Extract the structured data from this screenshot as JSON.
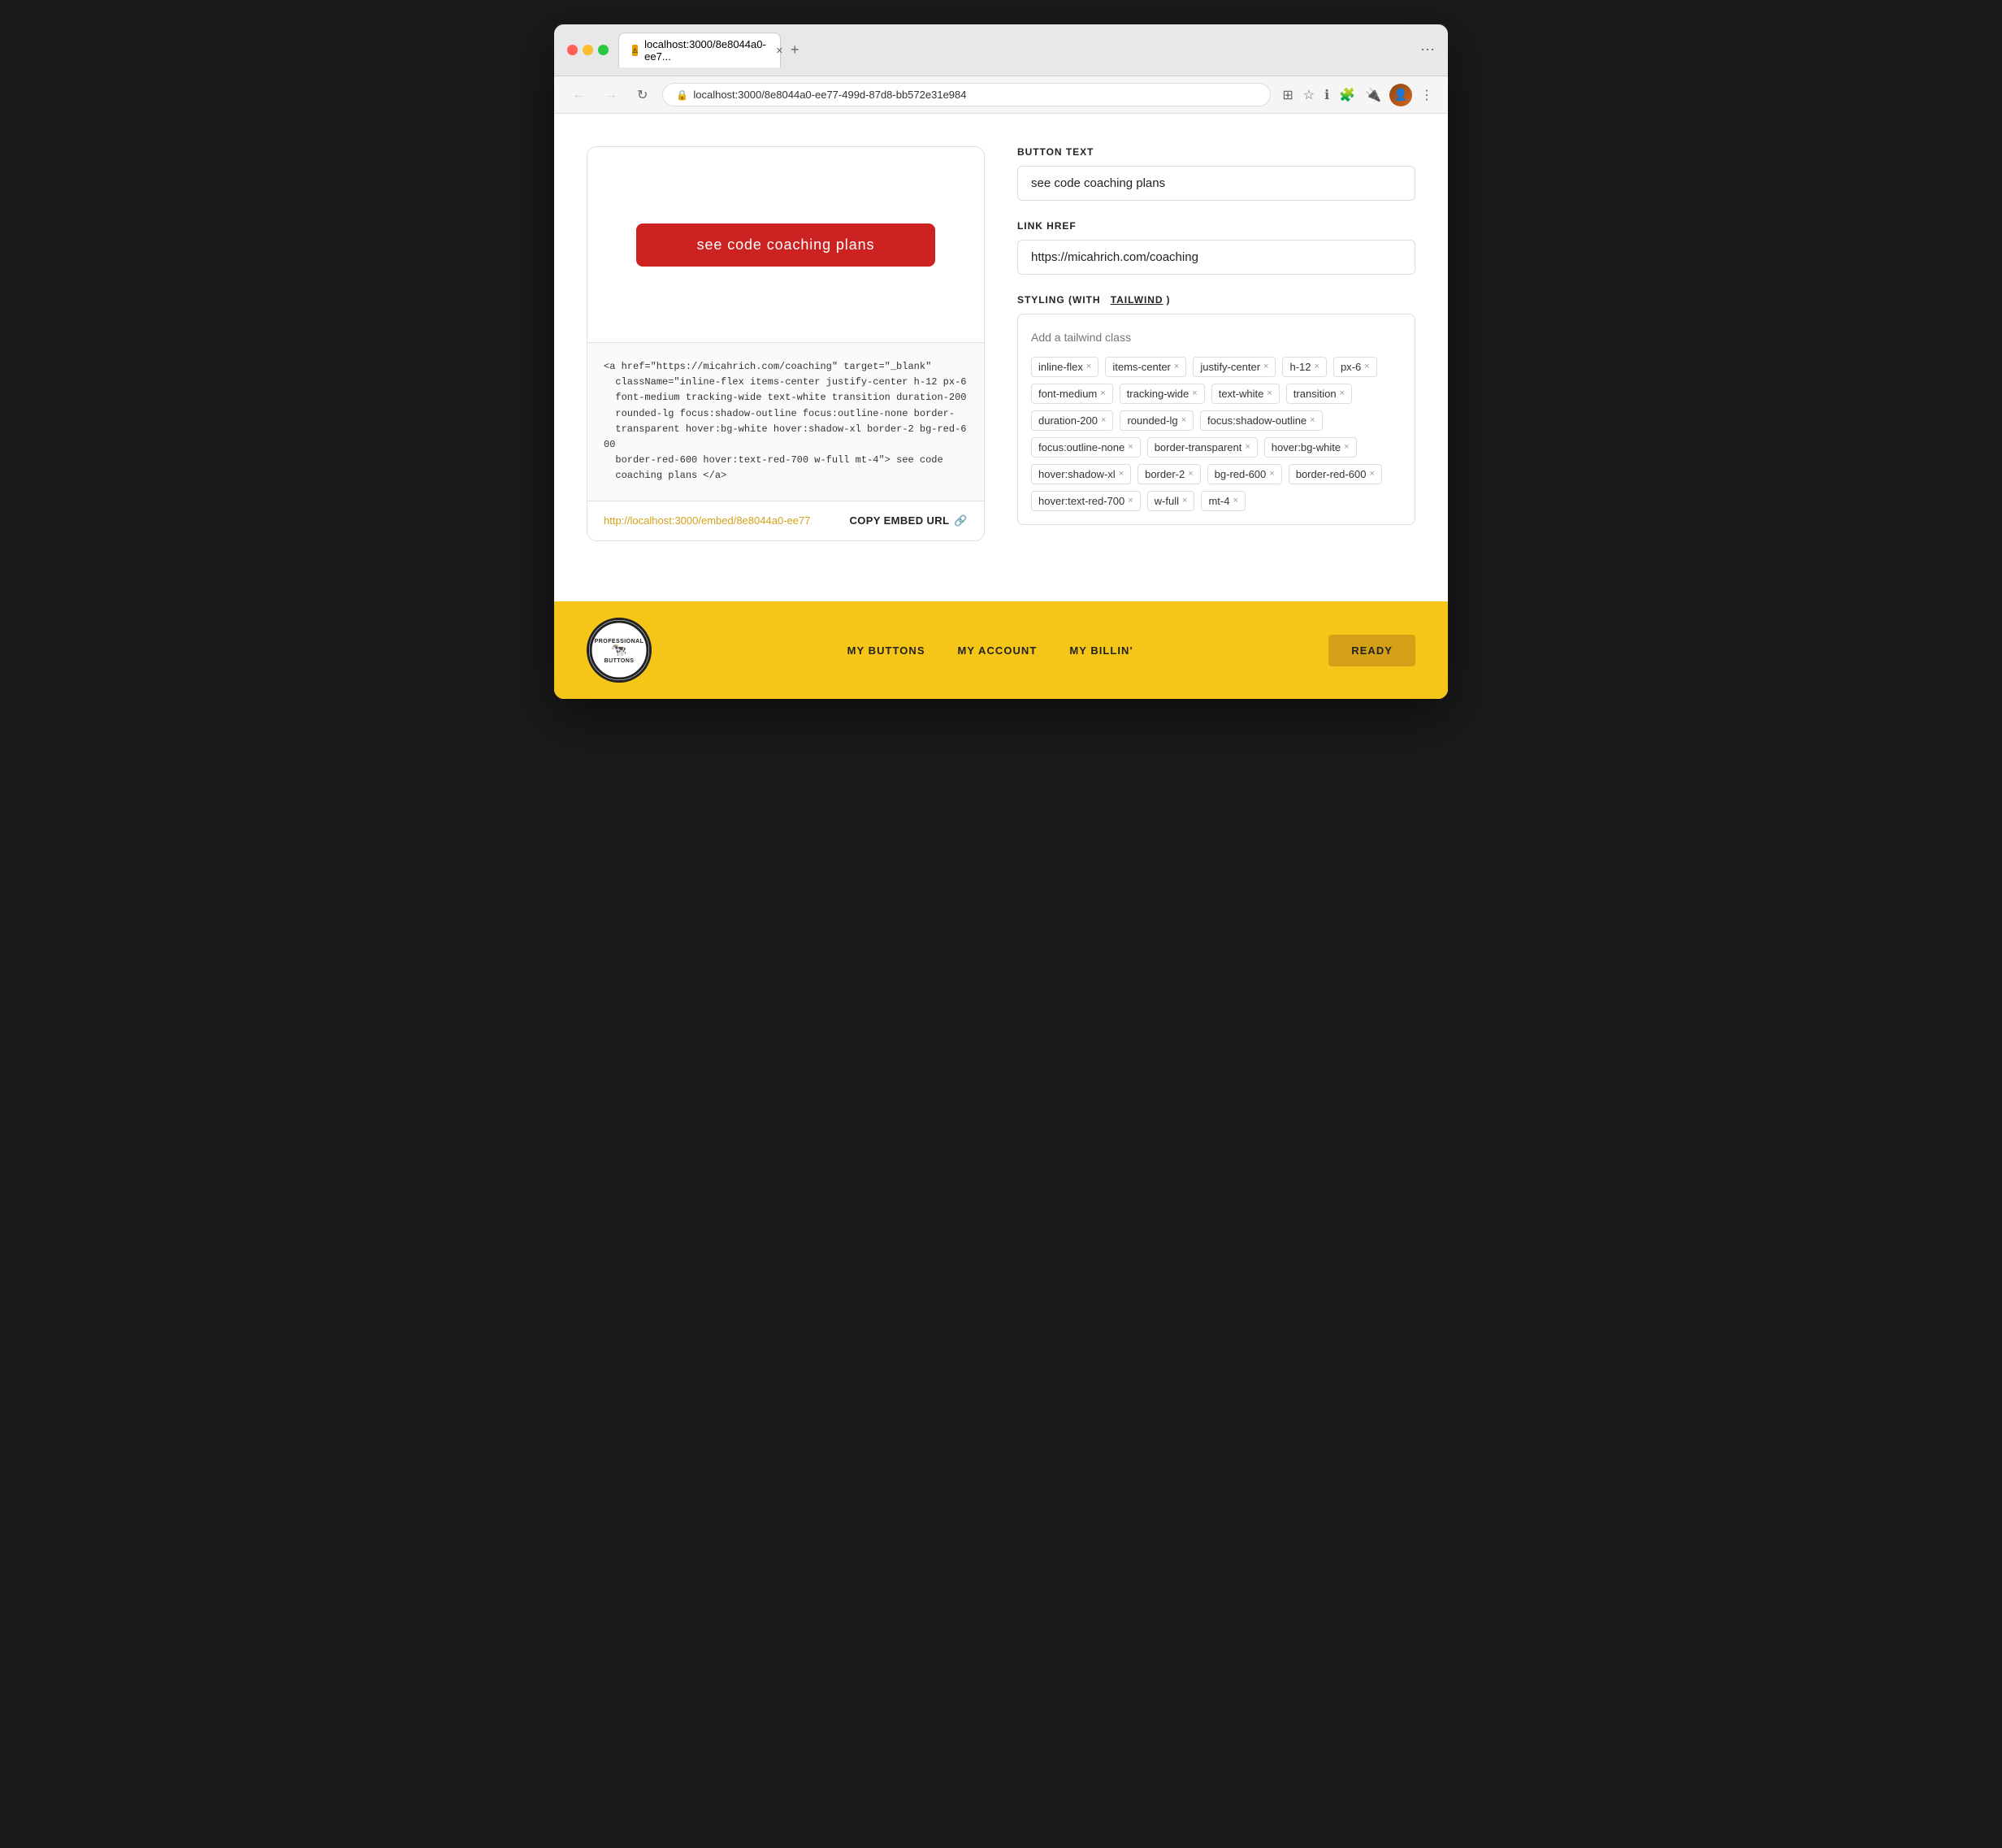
{
  "browser": {
    "tab_label": "localhost:3000/8e8044a0-ee7...",
    "address": "localhost:3000/8e8044a0-ee77-499d-87d8-bb572e31e984",
    "nav_back": "←",
    "nav_forward": "→",
    "nav_refresh": "↻"
  },
  "preview": {
    "button_text": "see code coaching plans",
    "button_style": "red"
  },
  "code": {
    "content": "<a href=\"https://micahrich.com/coaching\" target=\"_blank\"\n  className=\"inline-flex items-center justify-center h-12 px-6\n  font-medium tracking-wide text-white transition duration-200\n  rounded-lg focus:shadow-outline focus:outline-none border-\n  transparent hover:bg-white hover:shadow-xl border-2 bg-red-600\n  border-red-600 hover:text-red-700 w-full mt-4\"> see code\n  coaching plans </a>"
  },
  "embed": {
    "url": "http://localhost:3000/embed/8e8044a0-ee77",
    "copy_label": "COPY EMBED URL"
  },
  "controls": {
    "button_text_label": "BUTTON TEXT",
    "button_text_value": "see code coaching plans",
    "link_href_label": "LINK HREF",
    "link_href_value": "https://micahrich.com/coaching",
    "styling_label": "STYLING (WITH",
    "tailwind_label": "TAILWIND",
    "styling_suffix": ")",
    "class_placeholder": "Add a tailwind class",
    "tags": [
      "inline-flex",
      "items-center",
      "justify-center",
      "h-12",
      "px-6",
      "font-medium",
      "tracking-wide",
      "text-white",
      "transition",
      "duration-200",
      "rounded-lg",
      "focus:shadow-outline",
      "focus:outline-none",
      "border-transparent",
      "hover:bg-white",
      "hover:shadow-xl",
      "border-2",
      "bg-red-600",
      "border-red-600",
      "hover:text-red-700",
      "w-full",
      "mt-4"
    ]
  },
  "footer": {
    "nav_items": [
      "MY BUTTONS",
      "MY ACCOUNT",
      "MY BILLIN'"
    ],
    "ready_label": "READY",
    "logo_text": "PROFESSIONAL BUTTONS"
  }
}
